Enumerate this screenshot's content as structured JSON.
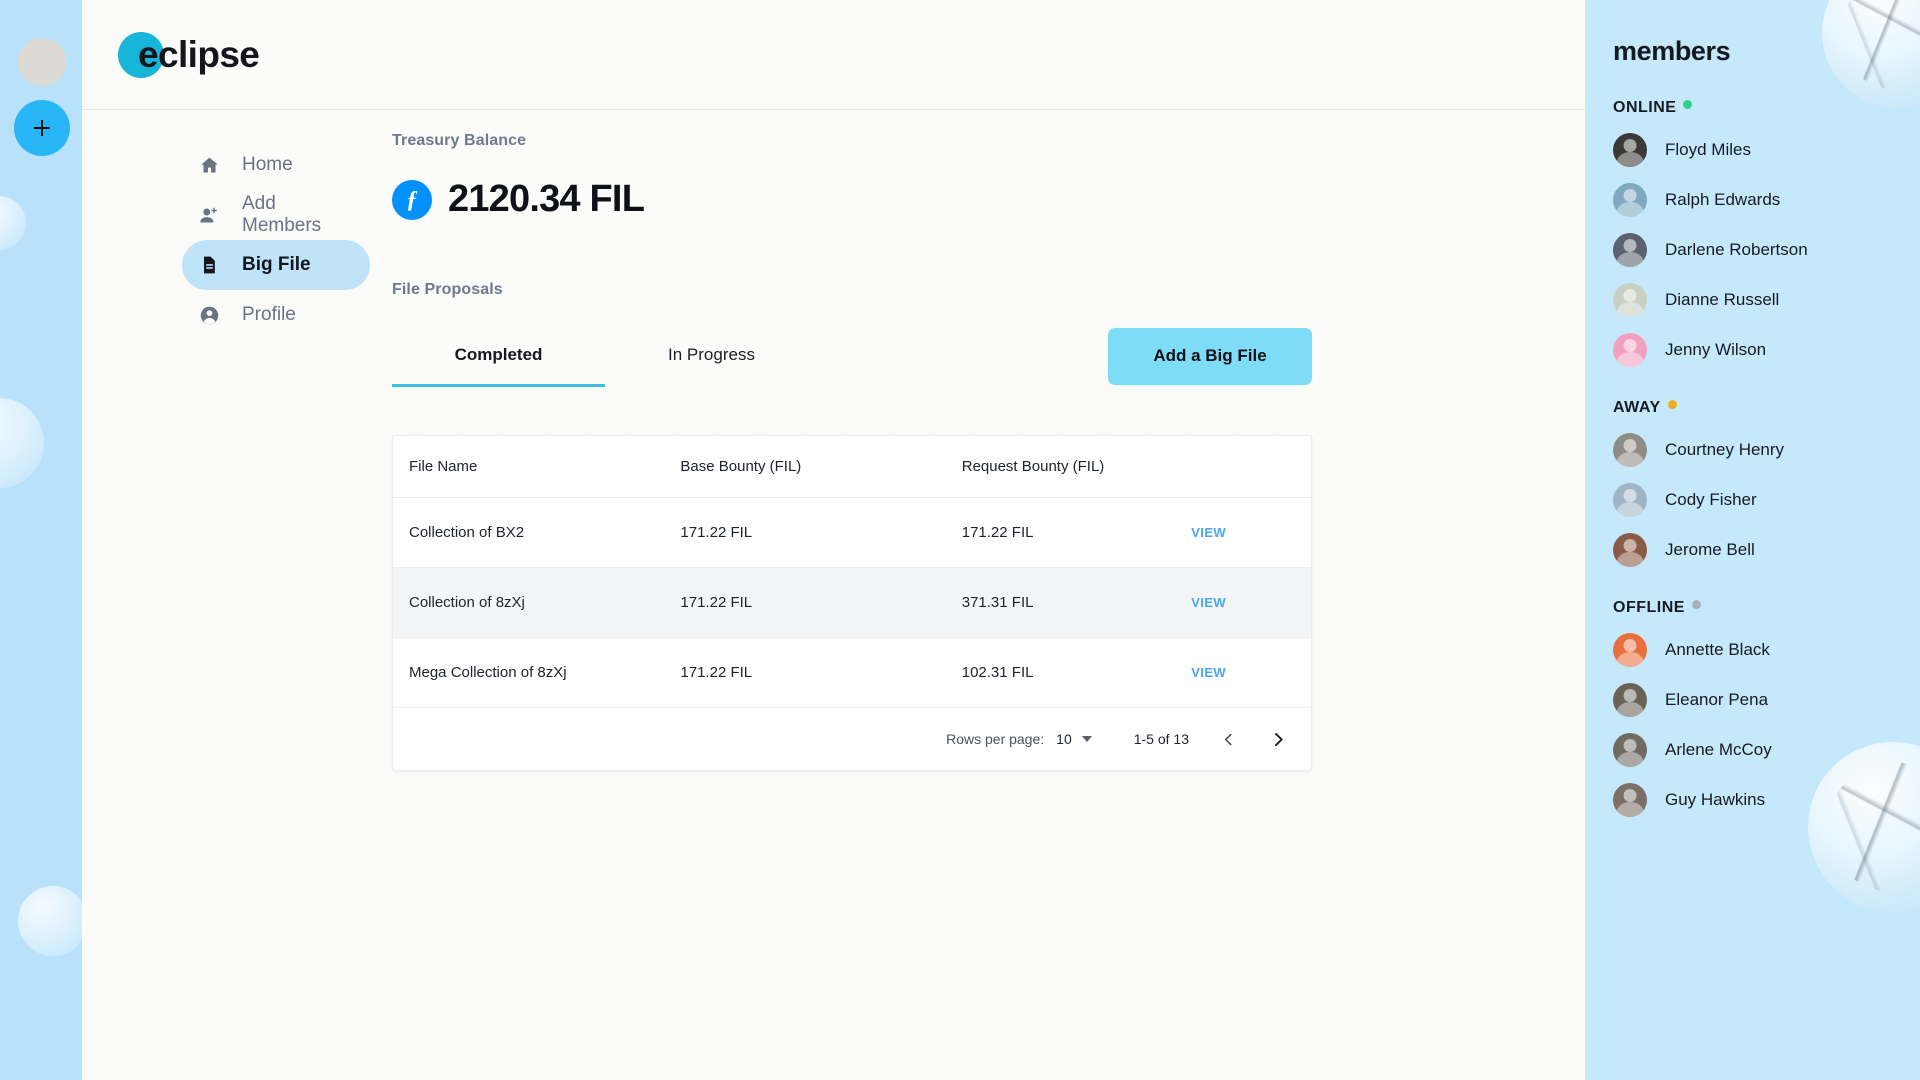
{
  "rail": {
    "avatar_name": "user-avatar",
    "add_label": "+"
  },
  "header": {
    "logo_text": "eclipse"
  },
  "sidebar": {
    "items": [
      {
        "label": "Home",
        "icon": "home-icon",
        "active": false
      },
      {
        "label": "Add Members",
        "icon": "add-person-icon",
        "active": false
      },
      {
        "label": "Big File",
        "icon": "document-icon",
        "active": true
      },
      {
        "label": "Profile",
        "icon": "account-circle-icon",
        "active": false
      }
    ]
  },
  "main": {
    "treasury_label": "Treasury Balance",
    "treasury_value": "2120.34 FIL",
    "fil_symbol": "ƒ",
    "proposals_label": "File Proposals",
    "tabs": [
      {
        "label": "Completed",
        "active": true
      },
      {
        "label": "In Progress",
        "active": false
      }
    ],
    "add_button_label": "Add a Big File",
    "table": {
      "columns": [
        "File Name",
        "Base Bounty (FIL)",
        "Request Bounty (FIL)",
        ""
      ],
      "rows": [
        {
          "file_name": "Collection of BX2",
          "base_bounty": "171.22 FIL",
          "request_bounty": "171.22 FIL",
          "action": "VIEW"
        },
        {
          "file_name": "Collection of 8zXj",
          "base_bounty": "171.22 FIL",
          "request_bounty": "371.31 FIL",
          "action": "VIEW"
        },
        {
          "file_name": "Mega Collection of 8zXj",
          "base_bounty": "171.22 FIL",
          "request_bounty": "102.31 FIL",
          "action": "VIEW"
        }
      ],
      "pagination": {
        "rows_per_page_label": "Rows per page:",
        "rows_per_page_value": "10",
        "range": "1-5 of 13",
        "prev_icon": "chevron-left-icon",
        "next_icon": "chevron-right-icon"
      }
    }
  },
  "members": {
    "title": "members",
    "groups": [
      {
        "label": "ONLINE",
        "dot_color": "#2ecf8a",
        "people": [
          {
            "name": "Floyd Miles",
            "avatar_color": "#3b3a38"
          },
          {
            "name": "Ralph Edwards",
            "avatar_color": "#7fa9bf"
          },
          {
            "name": "Darlene Robertson",
            "avatar_color": "#59626e"
          },
          {
            "name": "Dianne Russell",
            "avatar_color": "#c9cfc2"
          },
          {
            "name": "Jenny Wilson",
            "avatar_color": "#f2a0c0"
          }
        ]
      },
      {
        "label": "AWAY",
        "dot_color": "#f0ad1f",
        "people": [
          {
            "name": "Courtney Henry",
            "avatar_color": "#8f8c86"
          },
          {
            "name": "Cody Fisher",
            "avatar_color": "#9fb4c4"
          },
          {
            "name": "Jerome Bell",
            "avatar_color": "#8a5b45"
          }
        ]
      },
      {
        "label": "OFFLINE",
        "dot_color": "#aab1bb",
        "people": [
          {
            "name": "Annette Black",
            "avatar_color": "#e8703f"
          },
          {
            "name": "Eleanor Pena",
            "avatar_color": "#6b6258"
          },
          {
            "name": "Arlene McCoy",
            "avatar_color": "#6f6a62"
          },
          {
            "name": "Guy Hawkins",
            "avatar_color": "#7d6f68"
          }
        ]
      }
    ]
  },
  "colors": {
    "brand_cyan": "#17b6d8",
    "accent_blue": "#29b6f6",
    "button_blue": "#7fdcf7",
    "panel_blue": "#c6e8fb",
    "rail_blue": "#b9e2fa",
    "link_blue": "#49a7f0",
    "fil_blue": "#0090ff"
  }
}
